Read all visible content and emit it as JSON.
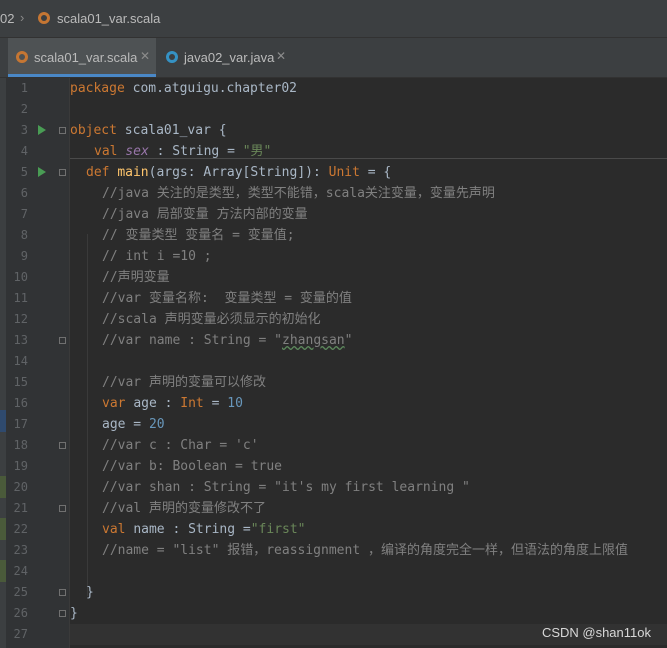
{
  "breadcrumb": {
    "prev": "02",
    "file": "scala01_var.scala"
  },
  "tabs": [
    {
      "label": "scala01_var.scala",
      "active": true
    },
    {
      "label": "java02_var.java",
      "active": false
    }
  ],
  "editor": {
    "lines": [
      {
        "n": "1",
        "parts": [
          [
            "kw",
            "package "
          ],
          [
            "",
            "com.atguigu.chapter02"
          ]
        ]
      },
      {
        "n": "2",
        "parts": []
      },
      {
        "n": "3",
        "run": true,
        "fold": true,
        "parts": [
          [
            "kw",
            "object "
          ],
          [
            "",
            "scala01_var {"
          ]
        ]
      },
      {
        "n": "4",
        "indent": 3,
        "parts": [
          [
            "kw",
            "val "
          ],
          [
            "fld",
            "sex"
          ],
          [
            "",
            " : String = "
          ],
          [
            "str",
            "\"男\""
          ]
        ]
      },
      {
        "n": "5",
        "run": true,
        "fold": true,
        "indent": 2,
        "parts": [
          [
            "kw",
            "def "
          ],
          [
            "fn",
            "main"
          ],
          [
            "",
            "(args: Array[String]): "
          ],
          [
            "kw",
            "Unit"
          ],
          [
            "",
            " = {"
          ]
        ]
      },
      {
        "n": "6",
        "indent": 4,
        "parts": [
          [
            "cm",
            "//java 关注的是类型，类型不能错，scala关注变量，变量先声明"
          ]
        ]
      },
      {
        "n": "7",
        "indent": 4,
        "parts": [
          [
            "cm",
            "//java 局部变量 方法内部的变量"
          ]
        ]
      },
      {
        "n": "8",
        "indent": 4,
        "parts": [
          [
            "cm",
            "// 变量类型 变量名 = 变量值;"
          ]
        ]
      },
      {
        "n": "9",
        "indent": 4,
        "parts": [
          [
            "cm",
            "// int i =10 ;"
          ]
        ]
      },
      {
        "n": "10",
        "indent": 4,
        "parts": [
          [
            "cm",
            "//声明变量"
          ]
        ]
      },
      {
        "n": "11",
        "indent": 4,
        "parts": [
          [
            "cm",
            "//var 变量名称:  变量类型 = 变量的值"
          ]
        ]
      },
      {
        "n": "12",
        "indent": 4,
        "parts": [
          [
            "cm",
            "//scala 声明变量必须显示的初始化"
          ]
        ]
      },
      {
        "n": "13",
        "indent": 4,
        "fold": true,
        "parts": [
          [
            "cm",
            "//var name : String = \""
          ],
          [
            "cm typo",
            "zhangsan"
          ],
          [
            "cm",
            "\""
          ]
        ]
      },
      {
        "n": "14",
        "parts": []
      },
      {
        "n": "15",
        "indent": 4,
        "parts": [
          [
            "cm",
            "//var 声明的变量可以修改"
          ]
        ]
      },
      {
        "n": "16",
        "indent": 4,
        "parts": [
          [
            "kw",
            "var "
          ],
          [
            "",
            "age : "
          ],
          [
            "kw",
            "Int"
          ],
          [
            "",
            " = "
          ],
          [
            "num",
            "10"
          ]
        ]
      },
      {
        "n": "17",
        "indent": 4,
        "parts": [
          [
            "",
            "age = "
          ],
          [
            "num",
            "20"
          ]
        ]
      },
      {
        "n": "18",
        "indent": 4,
        "fold": true,
        "parts": [
          [
            "cm",
            "//var c : Char = 'c'"
          ]
        ]
      },
      {
        "n": "19",
        "indent": 4,
        "parts": [
          [
            "cm",
            "//var b: Boolean = true"
          ]
        ]
      },
      {
        "n": "20",
        "indent": 4,
        "parts": [
          [
            "cm",
            "//var shan : String = \"it's my first learning \""
          ]
        ]
      },
      {
        "n": "21",
        "indent": 4,
        "fold": true,
        "parts": [
          [
            "cm",
            "//val 声明的变量修改不了"
          ]
        ]
      },
      {
        "n": "22",
        "indent": 4,
        "parts": [
          [
            "kw",
            "val "
          ],
          [
            "",
            "name : String ="
          ],
          [
            "str",
            "\"first\""
          ]
        ]
      },
      {
        "n": "23",
        "indent": 4,
        "parts": [
          [
            "cm",
            "//name = \"list\" 报错，reassignment ，编译的角度完全一样，但语法的角度上限值"
          ]
        ]
      },
      {
        "n": "24",
        "parts": []
      },
      {
        "n": "25",
        "indent": 2,
        "fold": true,
        "parts": [
          [
            "",
            "}"
          ]
        ]
      },
      {
        "n": "26",
        "fold": true,
        "parts": [
          [
            "",
            "}"
          ]
        ]
      },
      {
        "n": "27",
        "parts": []
      }
    ]
  },
  "watermark": "CSDN @shan11ok",
  "colors": {
    "keyword": "#cc7832",
    "comment": "#808080",
    "string": "#6a8759",
    "number": "#6897bb",
    "field": "#9876aa",
    "function": "#ffc66d",
    "text": "#a9b7c6",
    "background": "#2b2b2b"
  }
}
